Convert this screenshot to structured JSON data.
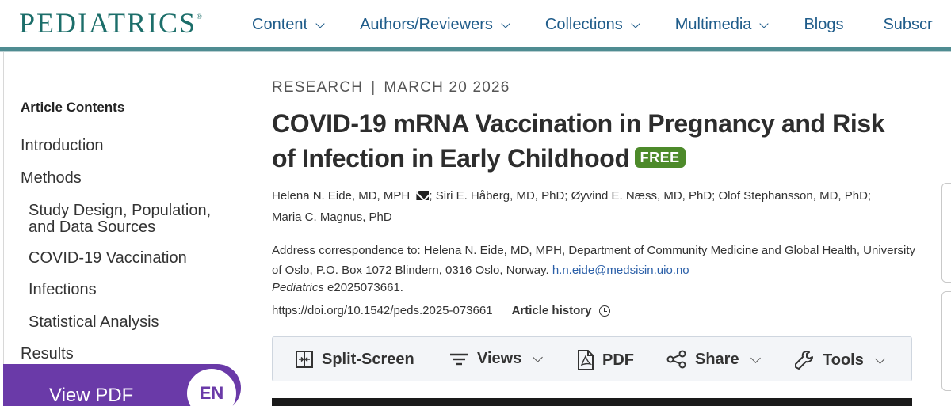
{
  "header": {
    "logo": "PEDIATRICS",
    "logo_mark": "®",
    "nav": [
      {
        "label": "Content"
      },
      {
        "label": "Authors/Reviewers"
      },
      {
        "label": "Collections"
      },
      {
        "label": "Multimedia"
      },
      {
        "label": "Blogs"
      },
      {
        "label": "Subscr"
      }
    ]
  },
  "sidebar": {
    "title": "Article Contents",
    "items": [
      {
        "label": "Introduction"
      },
      {
        "label": "Methods"
      },
      {
        "label": "Study Design, Population, and Data Sources"
      },
      {
        "label": "COVID-19 Vaccination"
      },
      {
        "label": "Infections"
      },
      {
        "label": "Statistical Analysis"
      },
      {
        "label": "Results"
      }
    ],
    "view_pdf": "View PDF",
    "language": "EN"
  },
  "article": {
    "type": "RESEARCH",
    "separator": "|",
    "date": "MARCH 20 2026",
    "title": "COVID-19 mRNA Vaccination in Pregnancy and Risk of Infection in Early Childhood",
    "badge": "FREE",
    "authors_line1_a": "Helena N. Eide, MD, MPH",
    "authors_line1_b": "; Siri E. Håberg, MD, PhD; Øyvind E. Næss, MD, PhD; Olof Stephansson, MD, PhD;",
    "authors_line2": "Maria C. Magnus, PhD",
    "address": "Address correspondence to: Helena N. Eide, MD, MPH, Department of Community Medicine and Global Health, University of Oslo, P.O. Box 1072 Blindern, 0316 Oslo, Norway.",
    "email": "h.n.eide@medsisin.uio.no",
    "journal": "Pediatrics",
    "article_id": "e2025073661.",
    "doi": "https://doi.org/10.1542/peds.2025-073661",
    "history": "Article history"
  },
  "toolbar": {
    "split_screen": "Split-Screen",
    "views": "Views",
    "pdf": "PDF",
    "share": "Share",
    "tools": "Tools"
  },
  "colors": {
    "brand_teal": "#1c6e6a",
    "nav_blue": "#1f5c8a",
    "free_green": "#4d8a2a",
    "pdf_purple": "#6a3aa8",
    "link_blue": "#2a5fa8"
  },
  "icons": [
    "envelope-icon",
    "clock-icon",
    "split-screen-icon",
    "views-icon",
    "pdf-icon",
    "share-icon",
    "tools-icon",
    "chevron-down-icon"
  ]
}
